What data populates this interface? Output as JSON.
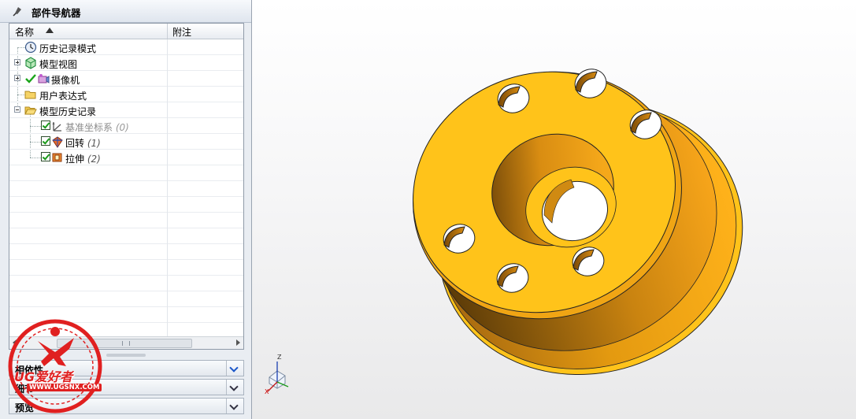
{
  "navigator": {
    "title": "部件导航器",
    "columns": {
      "name": "名称",
      "notes": "附注"
    },
    "rows": [
      {
        "label": "历史记录模式"
      },
      {
        "label": "模型视图"
      },
      {
        "label": "摄像机"
      },
      {
        "label": "用户表达式"
      },
      {
        "label": "模型历史记录"
      },
      {
        "label": "基准坐标系",
        "index": "(0)"
      },
      {
        "label": "回转",
        "index": "(1)"
      },
      {
        "label": "拉伸",
        "index": "(2)"
      }
    ],
    "sections": {
      "dependencies": "相依性",
      "details": "细节",
      "preview": "预览"
    }
  },
  "viewport": {
    "triad_axes": {
      "z": "Z",
      "x": "X"
    },
    "model_color": "#ffc31a"
  },
  "watermark": {
    "brand": "UG爱好者",
    "url": "WWW.UGSNX.COM"
  }
}
